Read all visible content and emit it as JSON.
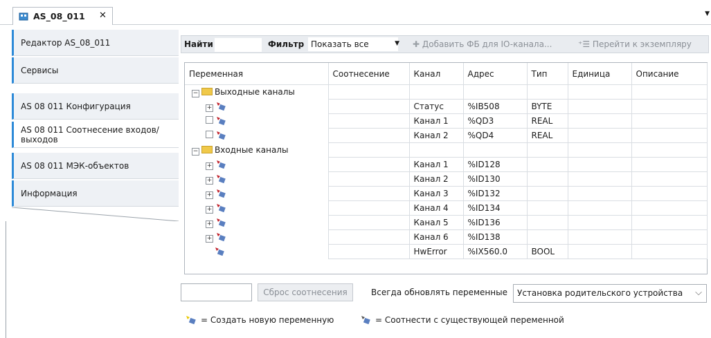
{
  "document_tab": {
    "title": "AS_08_011",
    "close": "✕"
  },
  "categories": [
    {
      "label": "Редактор AS_08_011"
    },
    {
      "label": "Сервисы"
    },
    {
      "label": "AS 08 011 Конфигурация"
    },
    {
      "label": "AS 08 011 Соотнесение входов/выходов"
    },
    {
      "label": "AS 08 011 МЭК-объектов"
    },
    {
      "label": "Информация"
    }
  ],
  "toolbar": {
    "find_label": "Найти",
    "filter_label": "Фильтр",
    "filter_value": "Показать все",
    "add_fb_label": "Добавить ФБ для IO-канала...",
    "goto_instance_label": "Перейти к экземпляру"
  },
  "grid": {
    "columns": [
      "Переменная",
      "Соотнесение",
      "Канал",
      "Адрес",
      "Тип",
      "Единица",
      "Описание"
    ],
    "groups": [
      {
        "label": "Выходные каналы",
        "rows": [
          {
            "channel": "Статус",
            "address": "%IB508",
            "type": "BYTE"
          },
          {
            "channel": "Канал 1",
            "address": "%QD3",
            "type": "REAL"
          },
          {
            "channel": "Канал 2",
            "address": "%QD4",
            "type": "REAL"
          }
        ]
      },
      {
        "label": "Входные каналы",
        "rows": [
          {
            "channel": "Канал 1",
            "address": "%ID128",
            "type": ""
          },
          {
            "channel": "Канал 2",
            "address": "%ID130",
            "type": ""
          },
          {
            "channel": "Канал 3",
            "address": "%ID132",
            "type": ""
          },
          {
            "channel": "Канал 4",
            "address": "%ID134",
            "type": ""
          },
          {
            "channel": "Канал 5",
            "address": "%ID136",
            "type": ""
          },
          {
            "channel": "Канал 6",
            "address": "%ID138",
            "type": ""
          }
        ]
      }
    ],
    "last_row": {
      "channel": "HwError",
      "address": "%IX560.0",
      "type": "BOOL"
    }
  },
  "bottom": {
    "reset_button": "Сброс соотнесения",
    "always_update_label": "Всегда обновлять переменные",
    "parent_select_value": "Установка родительского устройства"
  },
  "legend": {
    "create_new": "= Создать новую переменную",
    "map_existing": "= Соотнести с существующей переменной"
  },
  "colors": {
    "accent": "#2d8ad8",
    "folder": "#f0c94a"
  }
}
